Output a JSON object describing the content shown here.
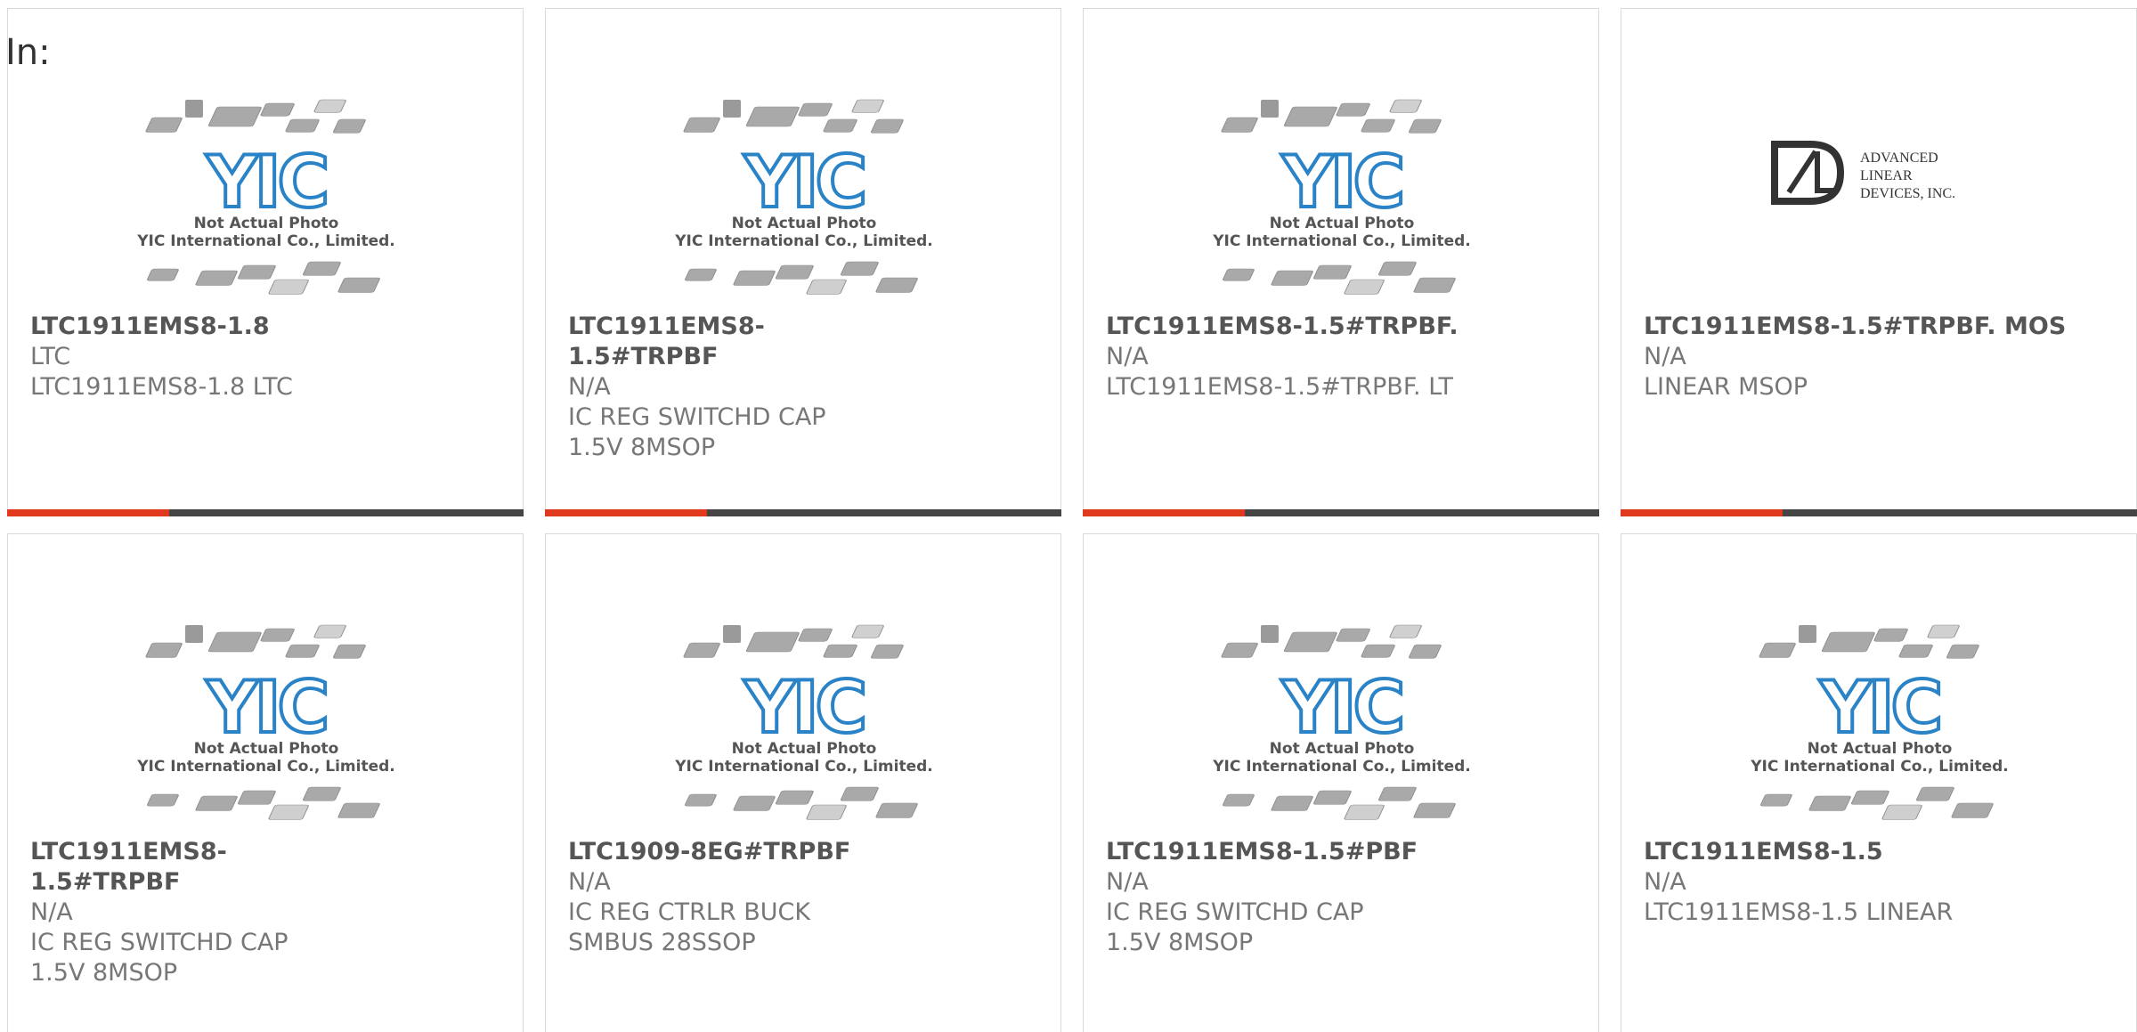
{
  "header": {
    "label": "In:"
  },
  "colors": {
    "accent": "#e1391d",
    "bar": "#454545",
    "yic_blue": "#2a83c6"
  },
  "yic_photo": {
    "line1": "Not Actual Photo",
    "line2": "YIC International Co., Limited.",
    "logo": "YIC"
  },
  "ald_logo": {
    "line1": "ADVANCED",
    "line2": "LINEAR",
    "line3": "DEVICES, INC."
  },
  "products": [
    {
      "part": "LTC1911EMS8-1.8",
      "mfr": "LTC",
      "desc": "LTC1911EMS8-1.8 LTC",
      "image": "yic-placeholder"
    },
    {
      "part": "LTC1911EMS8-1.5#TRPBF",
      "mfr": "N/A",
      "desc": "IC REG SWITCHD CAP 1.5V 8MSOP",
      "image": "yic-placeholder"
    },
    {
      "part": "LTC1911EMS8-1.5#TRPBF.",
      "mfr": "N/A",
      "desc": "LTC1911EMS8-1.5#TRPBF. LT",
      "image": "yic-placeholder"
    },
    {
      "part": "LTC1911EMS8-1.5#TRPBF. MOS",
      "mfr": "N/A",
      "desc": "LINEAR MSOP",
      "image": "ald-logo"
    },
    {
      "part": "LTC1911EMS8-1.5#TRPBF",
      "mfr": "N/A",
      "desc": "IC REG SWITCHD CAP 1.5V 8MSOP",
      "image": "yic-placeholder"
    },
    {
      "part": "LTC1909-8EG#TRPBF",
      "mfr": "N/A",
      "desc": "IC REG CTRLR BUCK SMBUS 28SSOP",
      "image": "yic-placeholder"
    },
    {
      "part": "LTC1911EMS8-1.5#PBF",
      "mfr": "N/A",
      "desc": "IC REG SWITCHD CAP 1.5V 8MSOP",
      "image": "yic-placeholder"
    },
    {
      "part": "LTC1911EMS8-1.5",
      "mfr": "N/A",
      "desc": "LTC1911EMS8-1.5 LINEAR",
      "image": "yic-placeholder"
    }
  ]
}
